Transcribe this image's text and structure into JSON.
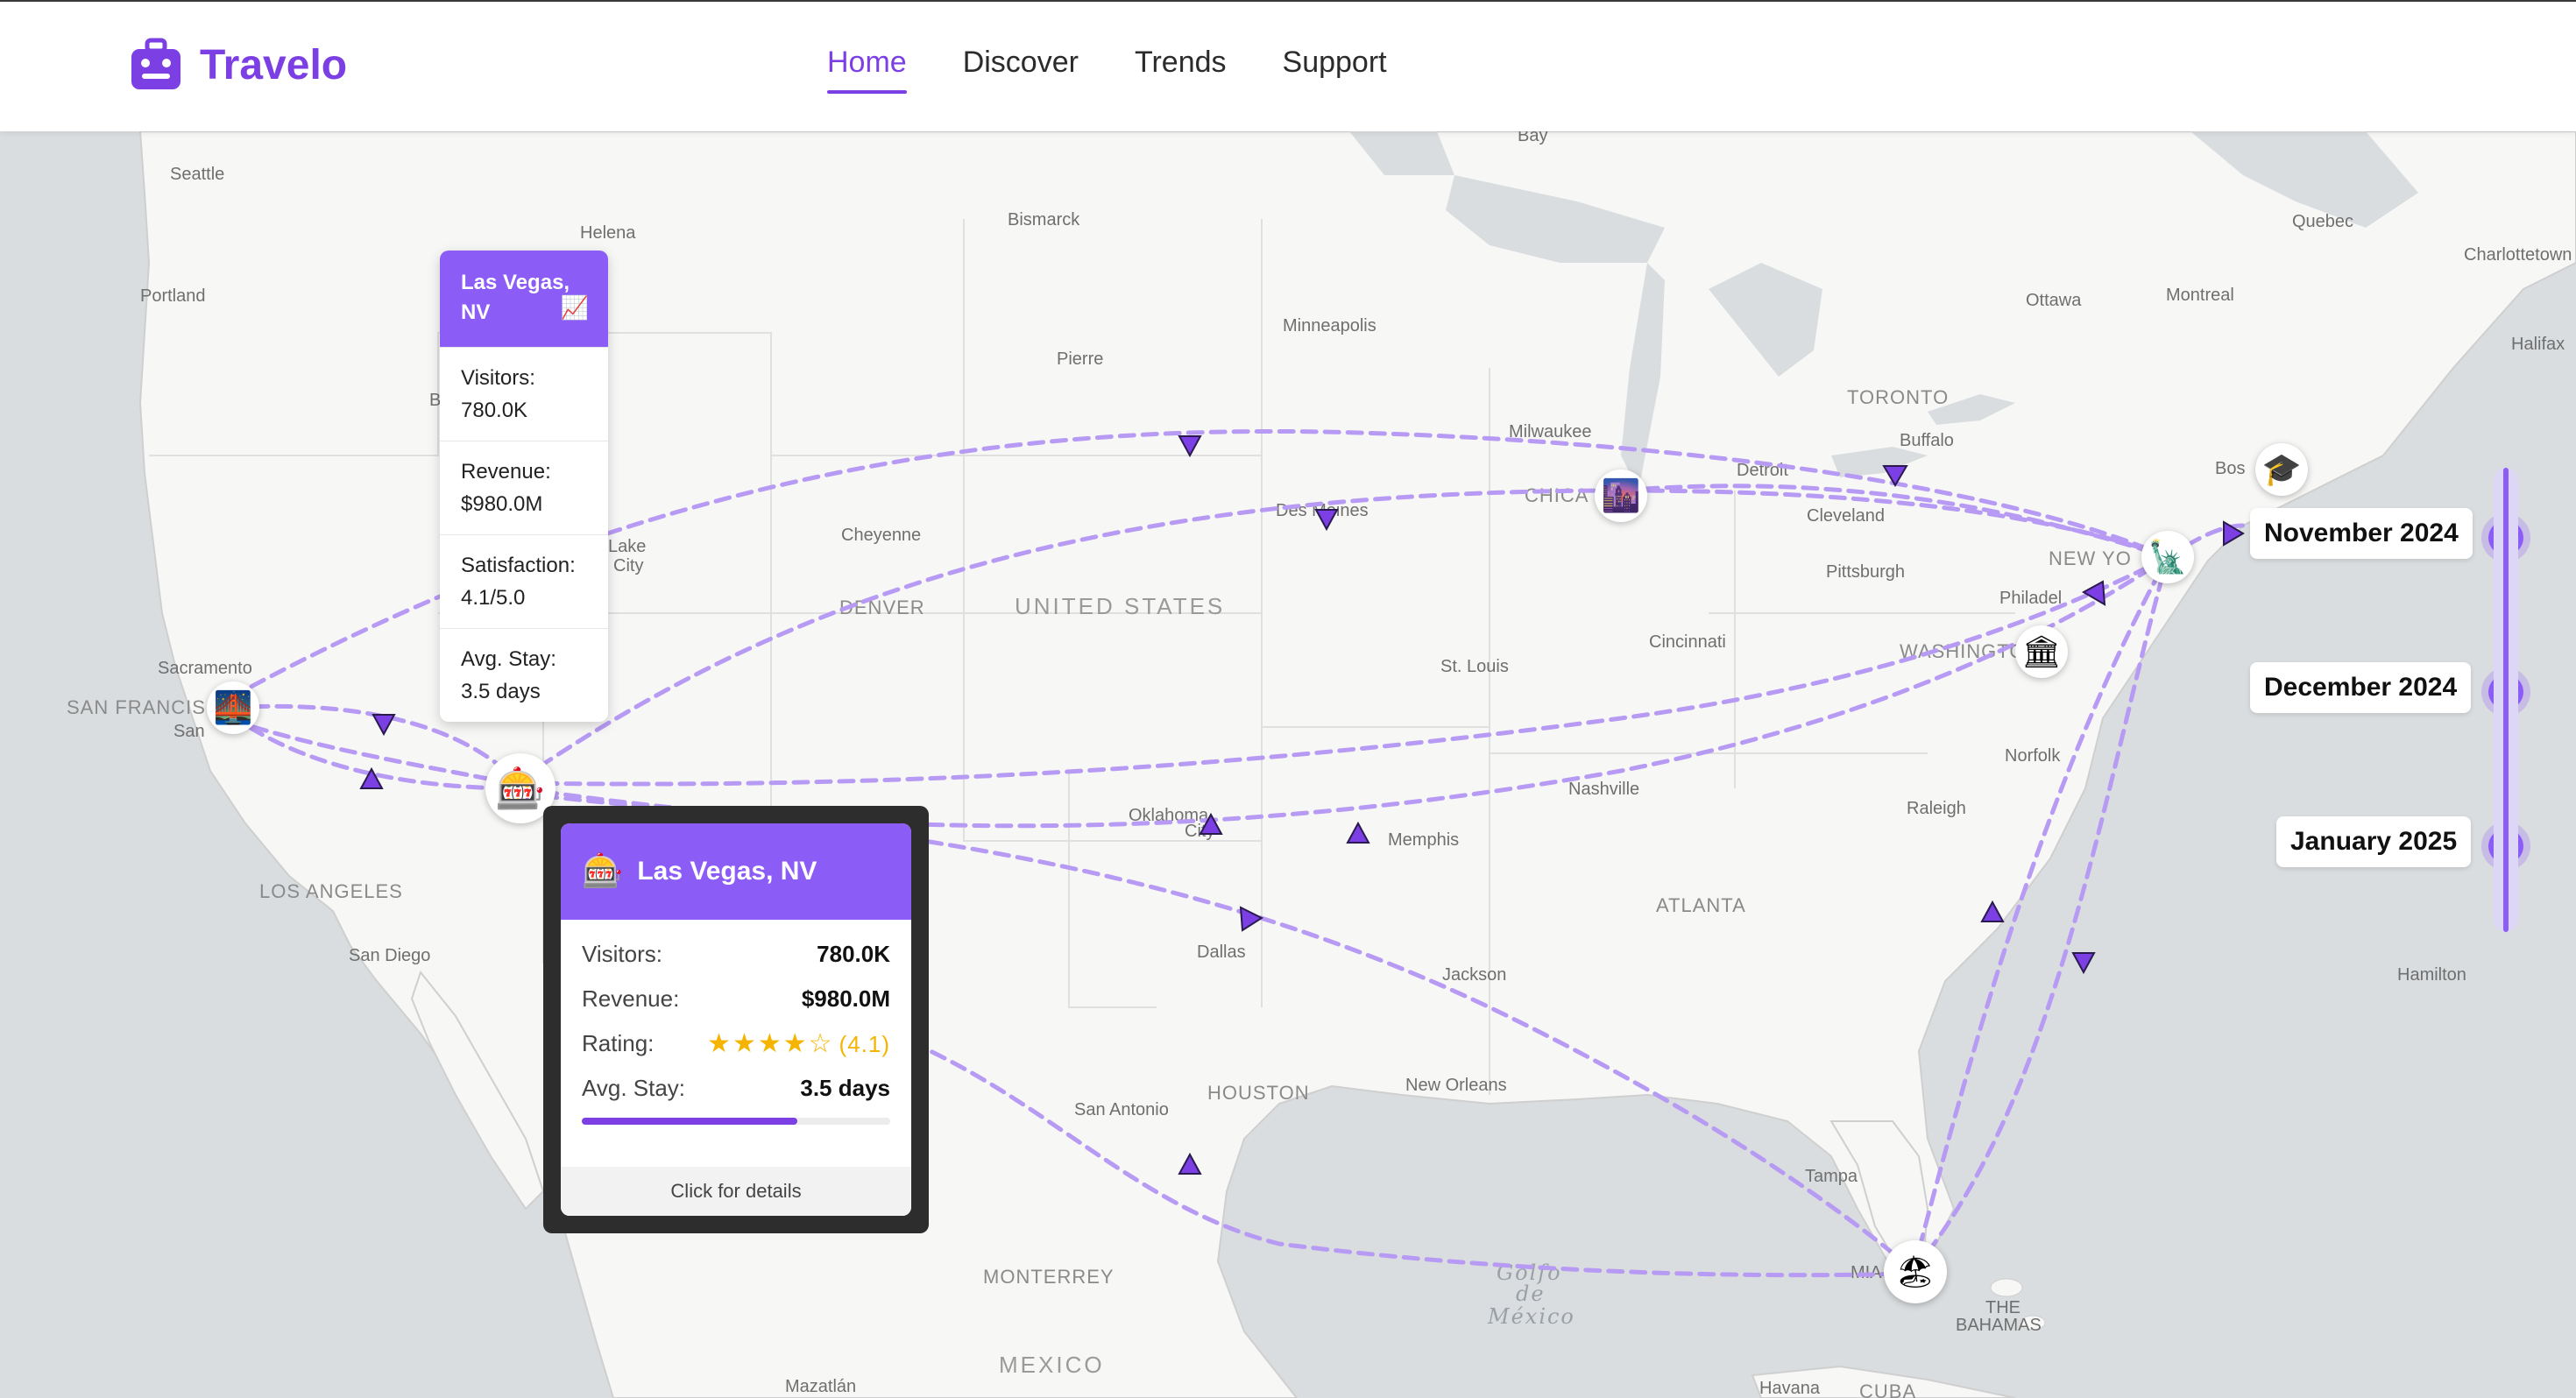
{
  "header": {
    "brand": "Travelo",
    "nav": [
      {
        "label": "Home",
        "active": true
      },
      {
        "label": "Discover",
        "active": false
      },
      {
        "label": "Trends",
        "active": false
      },
      {
        "label": "Support",
        "active": false
      }
    ]
  },
  "colors": {
    "accent": "#8b5cf6",
    "brand": "#7b3fe4",
    "route": "#b79af3"
  },
  "map_labels": {
    "cities": [
      "Seattle",
      "Helena",
      "Bismarck",
      "Portland",
      "Pierre",
      "Minneapolis",
      "Quebec",
      "Charlottetown",
      "Ottawa",
      "Montreal",
      "Halifax",
      "TORONTO",
      "Buffalo",
      "Milwaukee",
      "Detroit",
      "Bos",
      "Cheyenne",
      "Des Moines",
      "CHICA",
      "Cleveland",
      "DENVER",
      "Pittsburgh",
      "NEW YO",
      "Philadel",
      "Sacramento",
      "Lake City",
      "Cincinnati",
      "WASHINGTO",
      "St. Louis",
      "SAN FRANCIS",
      "San",
      "Nashville",
      "Norfolk",
      "Oklahoma City",
      "Memphis",
      "Raleigh",
      "LOS ANGELES",
      "ATLANTA",
      "San Diego",
      "Dallas",
      "Jackson",
      "Hamilton",
      "HOUSTON",
      "New Orleans",
      "San Antonio",
      "Tampa",
      "MONTERREY",
      "MIAMI",
      "Mazatlán",
      "Havana",
      "CUBA",
      "THE BAHAMAS",
      "Bay",
      "B"
    ],
    "country": "UNITED STATES",
    "country2": "MEXICO",
    "water": [
      "Golfo",
      "de",
      "México"
    ]
  },
  "tooltip_small": {
    "title": "Las Vegas, NV",
    "trend_icon": "chart-increasing-icon",
    "rows": [
      {
        "label": "Visitors:",
        "value": "780.0K"
      },
      {
        "label": "Revenue:",
        "value": "$980.0M"
      },
      {
        "label": "Satisfaction:",
        "value": "4.1/5.0"
      },
      {
        "label": "Avg. Stay:",
        "value": "3.5 days"
      }
    ]
  },
  "popup": {
    "title": "Las Vegas, NV",
    "icon": "slot-machine-icon",
    "visitors_label": "Visitors:",
    "visitors": "780.0K",
    "revenue_label": "Revenue:",
    "revenue": "$980.0M",
    "rating_label": "Rating:",
    "rating_stars": "★★★★☆",
    "rating_value": "(4.1)",
    "rating": 4.1,
    "stay_label": "Avg. Stay:",
    "stay": "3.5 days",
    "stay_progress_percent": 70,
    "footer": "Click for details"
  },
  "markers": [
    {
      "name": "san-francisco-marker",
      "icon": "golden-gate-bridge-icon",
      "glyph": "🌉"
    },
    {
      "name": "las-vegas-marker",
      "icon": "slot-machine-icon",
      "glyph": "🎰"
    },
    {
      "name": "chicago-marker",
      "icon": "cityscape-icon",
      "glyph": "🌆"
    },
    {
      "name": "washington-marker",
      "icon": "classical-building-icon",
      "glyph": "🏛"
    },
    {
      "name": "new-york-marker",
      "icon": "statue-of-liberty-icon",
      "glyph": "🗽"
    },
    {
      "name": "boston-marker",
      "icon": "graduation-cap-icon",
      "glyph": "🎓"
    },
    {
      "name": "miami-marker",
      "icon": "beach-umbrella-icon",
      "glyph": "🏖"
    }
  ],
  "timeline": [
    {
      "label": "November 2024"
    },
    {
      "label": "December 2024"
    },
    {
      "label": "January 2025"
    }
  ]
}
